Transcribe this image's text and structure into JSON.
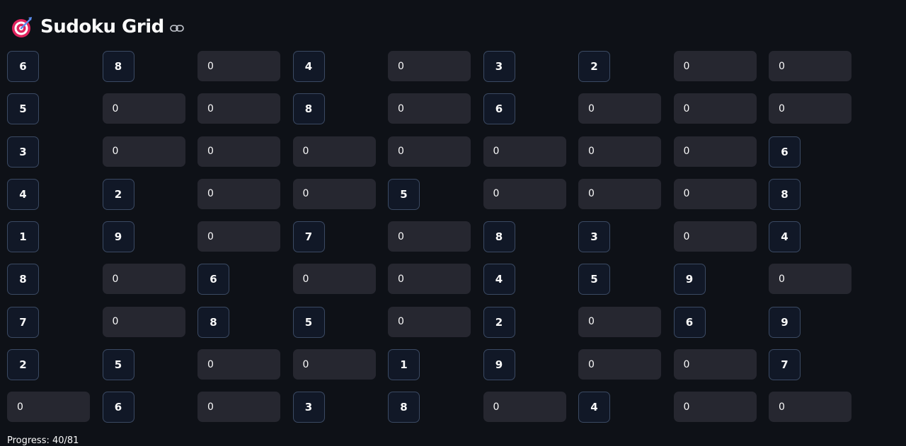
{
  "header": {
    "title": "Sudoku Grid",
    "icon": "target-dart-icon",
    "anchor_icon": "link-icon"
  },
  "grid": {
    "rows": [
      [
        6,
        8,
        0,
        4,
        0,
        3,
        2,
        0,
        0
      ],
      [
        5,
        0,
        0,
        8,
        0,
        6,
        0,
        0,
        0
      ],
      [
        3,
        0,
        0,
        0,
        0,
        0,
        0,
        0,
        6
      ],
      [
        4,
        2,
        0,
        0,
        5,
        0,
        0,
        0,
        8
      ],
      [
        1,
        9,
        0,
        7,
        0,
        8,
        3,
        0,
        4
      ],
      [
        8,
        0,
        6,
        0,
        0,
        4,
        5,
        9,
        0
      ],
      [
        7,
        0,
        8,
        5,
        0,
        2,
        0,
        6,
        9
      ],
      [
        2,
        5,
        0,
        0,
        1,
        9,
        0,
        0,
        7
      ],
      [
        0,
        6,
        0,
        3,
        8,
        0,
        4,
        0,
        0
      ]
    ]
  },
  "progress": {
    "text": "Progress: 40/81"
  },
  "colors": {
    "background": "#0e1117",
    "given_cell_bg": "#111827",
    "given_cell_border": "#3b4a63",
    "empty_cell_bg": "#262730",
    "text": "#fafafa"
  }
}
